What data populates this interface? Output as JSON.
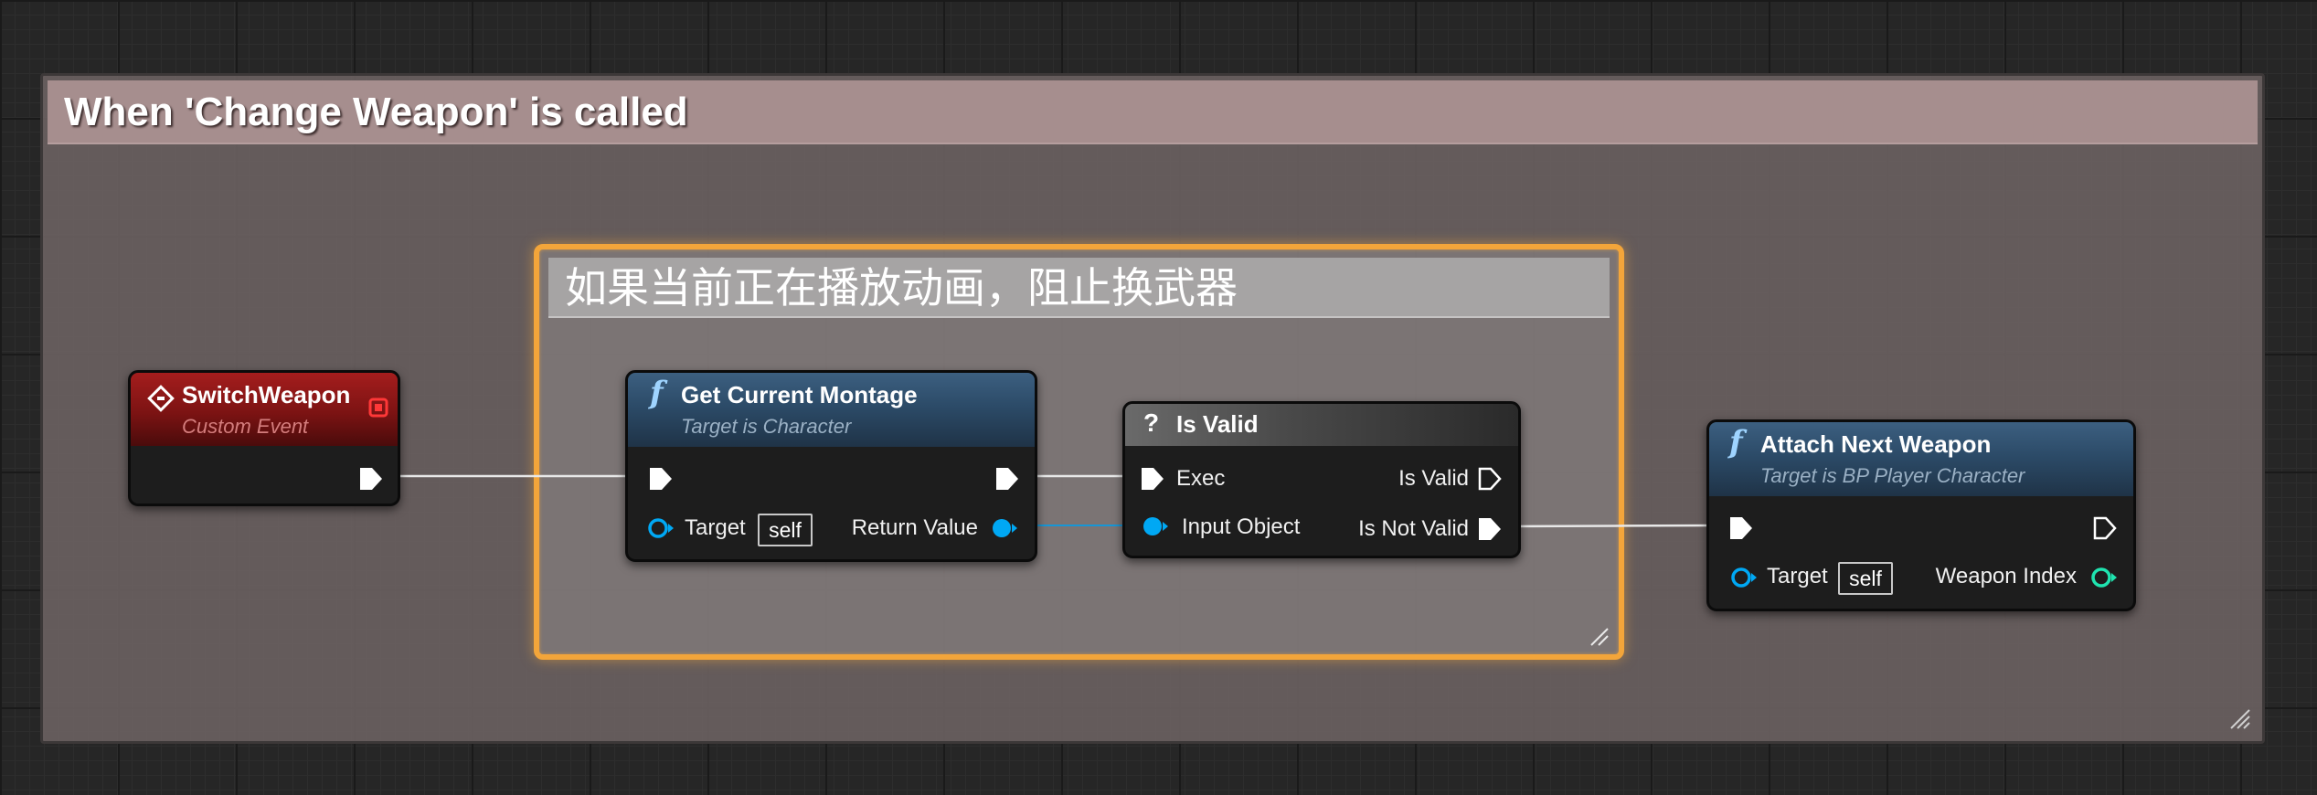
{
  "graph": {
    "outer_comment": {
      "title": "When 'Change Weapon' is called"
    },
    "inner_comment": {
      "title": "如果当前正在播放动画，阻止换武器"
    }
  },
  "nodes": {
    "switch_weapon": {
      "title": "SwitchWeapon",
      "subtitle": "Custom Event",
      "icon": "event-diamond-icon"
    },
    "get_current_montage": {
      "title": "Get Current Montage",
      "subtitle": "Target is Character",
      "icon": "function-icon",
      "icon_glyph": "f",
      "pins": {
        "target_label": "Target",
        "target_default": "self",
        "return_label": "Return Value"
      }
    },
    "is_valid": {
      "title": "Is Valid",
      "icon": "question-icon",
      "icon_glyph": "?",
      "pins": {
        "exec_label": "Exec",
        "is_valid_label": "Is Valid",
        "input_object_label": "Input Object",
        "is_not_valid_label": "Is Not Valid"
      }
    },
    "attach_next_weapon": {
      "title": "Attach Next Weapon",
      "subtitle": "Target is BP Player Character",
      "icon": "function-icon",
      "icon_glyph": "f",
      "pins": {
        "target_label": "Target",
        "target_default": "self",
        "weapon_index_label": "Weapon Index"
      }
    }
  },
  "colors": {
    "exec_wire": "#ffffff",
    "object_pin": "#00a8f4",
    "integer_pin": "#1fe3af",
    "function_header": "#2c4b68",
    "event_header": "#7c1313",
    "delegate_pin": "#ff3838",
    "comment_highlight": "#f3a53a"
  }
}
